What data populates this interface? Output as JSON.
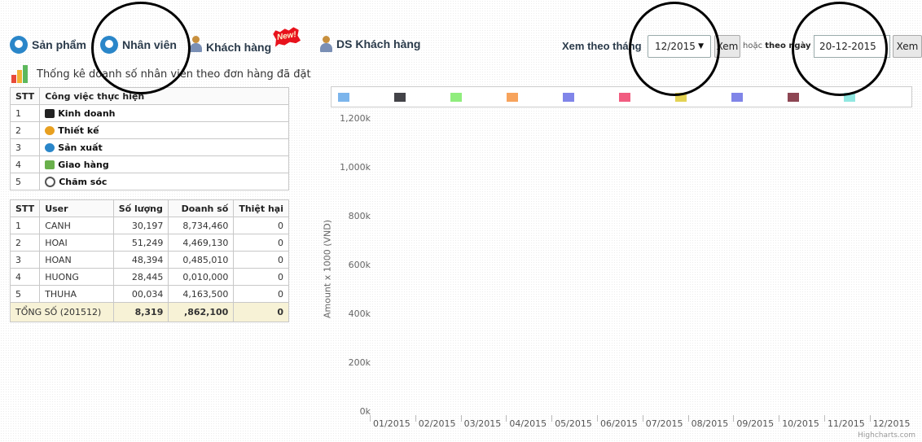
{
  "page_title": "",
  "nav": [
    {
      "label": "Sản phẩm",
      "icon": "products-icon"
    },
    {
      "label": "Nhân viên",
      "icon": "staff-icon"
    },
    {
      "label": "Khách hàng",
      "icon": "customer-icon",
      "badge": "New!"
    },
    {
      "label": "DS Khách hàng",
      "icon": "customer-list-icon"
    }
  ],
  "filter": {
    "month_label": "Xem theo tháng",
    "month_value": "12/2015",
    "view_button": "Xem",
    "or_text": "hoặc",
    "day_label": "theo ngày",
    "day_value": "20-12-2015",
    "view_button_2": "Xem"
  },
  "stats_title": "Thống kê doanh số nhân viên theo đơn hàng đã đặt",
  "tasks_table": {
    "headers": [
      "STT",
      "Công việc thực hiện"
    ],
    "rows": [
      {
        "stt": "1",
        "name": "Kinh doanh",
        "icon": "hat-icon",
        "color": "#222222"
      },
      {
        "stt": "2",
        "name": "Thiết kế",
        "icon": "palette-icon",
        "color": "#e8a020"
      },
      {
        "stt": "3",
        "name": "Sản xuất",
        "icon": "gear-icon",
        "color": "#2a86c9"
      },
      {
        "stt": "4",
        "name": "Giao hàng",
        "icon": "delivery-truck-icon",
        "color": "#6ab04c"
      },
      {
        "stt": "5",
        "name": "Chăm sóc",
        "icon": "care-face-icon",
        "color": "#555555"
      }
    ]
  },
  "users_table": {
    "headers": [
      "STT",
      "User",
      "Số lượng",
      "Doanh số",
      "Thiệt hại"
    ],
    "rows": [
      {
        "stt": "1",
        "user": "CANH",
        "qty": "30,197",
        "sales": "8,734,460",
        "damage": "0"
      },
      {
        "stt": "2",
        "user": "HOAI",
        "qty": "51,249",
        "sales": "4,469,130",
        "damage": "0"
      },
      {
        "stt": "3",
        "user": "HOAN",
        "qty": "48,394",
        "sales": "0,485,010",
        "damage": "0"
      },
      {
        "stt": "4",
        "user": "HUONG",
        "qty": "28,445",
        "sales": "0,010,000",
        "damage": "0"
      },
      {
        "stt": "5",
        "user": "THUHA",
        "qty": "00,034",
        "sales": "4,163,500",
        "damage": "0"
      }
    ],
    "total": {
      "label": "TỔNG SỐ (201512)",
      "qty": "8,319",
      "sales": ",862,100",
      "damage": "0"
    }
  },
  "chart": {
    "legend_colors": [
      "#7cb5ec",
      "#434348",
      "#90ed7d",
      "#f7a35c",
      "#8085e9",
      "#f15c80",
      "#e4d354",
      "#8085e8",
      "#8d4653",
      "#91e8e1"
    ],
    "credit": "Highcharts.com"
  },
  "chart_data": {
    "type": "bar",
    "categories": [
      "01/2015",
      "02/2015",
      "03/2015",
      "04/2015",
      "05/2015",
      "06/2015",
      "07/2015",
      "08/2015",
      "09/2015",
      "10/2015",
      "11/2015",
      "12/2015"
    ],
    "series": [],
    "ylabel": "Amount x 1000 (VND)",
    "xlabel": "",
    "ylim": [
      0,
      1200000
    ],
    "yticks": [
      "0k",
      "200k",
      "400k",
      "600k",
      "800k",
      "1,000k",
      "1,200k"
    ],
    "grid": false,
    "legend": "top"
  }
}
